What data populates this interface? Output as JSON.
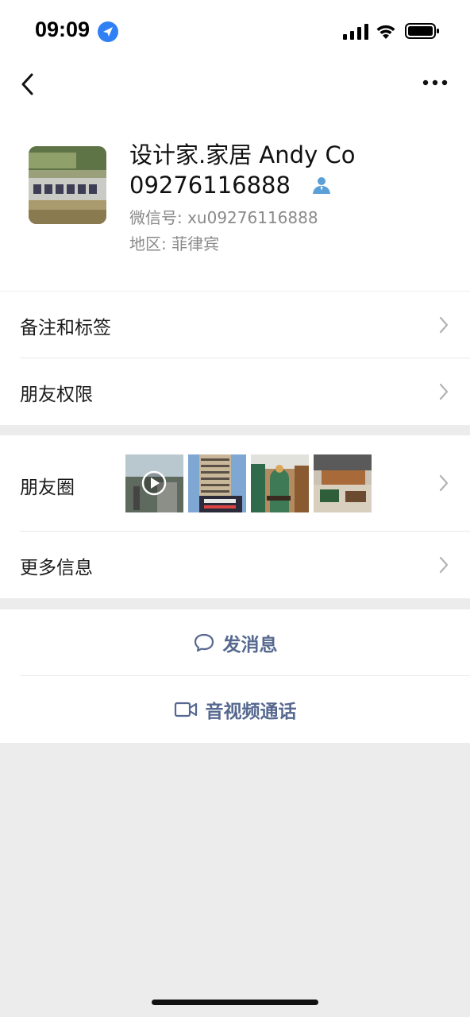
{
  "status_bar": {
    "time": "09:09"
  },
  "profile": {
    "name_line1": "设计家.家居  Andy Co",
    "name_line2": "09276116888",
    "wechat_id": "微信号: xu09276116888",
    "region": "地区: 菲律宾"
  },
  "rows": {
    "remarks_tags": "备注和标签",
    "friend_permissions": "朋友权限",
    "moments": "朋友圈",
    "more_info": "更多信息"
  },
  "actions": {
    "send_message": "发消息",
    "video_call": "音视频通话"
  },
  "colors": {
    "accent": "#56688f",
    "location_badge": "#2f7ff5",
    "contact_badge": "#5a9fd6",
    "background": "#ececec"
  },
  "icons": {
    "location": "location-arrow-icon",
    "back": "chevron-left-icon",
    "more": "more-dots-icon",
    "contact": "contact-person-icon",
    "message": "chat-bubble-icon",
    "video": "video-camera-icon",
    "moments_play": "play-icon"
  }
}
